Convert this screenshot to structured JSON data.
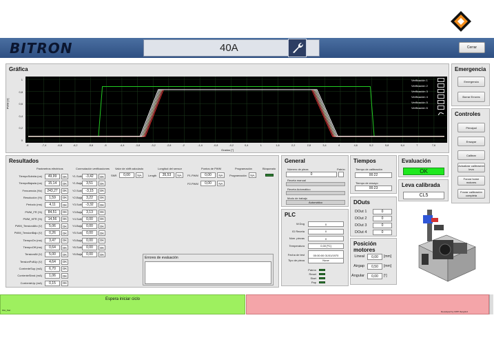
{
  "app": {
    "logo": "BITRON",
    "machine": "40A",
    "close_label": "Cerrar"
  },
  "graph": {
    "title": "Gráfica",
    "ylabel": "PWM [V]",
    "xlabel": "Grados [°]",
    "yticks": [
      "1",
      "0,8",
      "0,6",
      "0,4",
      "0,2",
      "0"
    ],
    "xticks": [
      "-8",
      "-7,4",
      "-6,8",
      "-6,2",
      "-5,6",
      "-5",
      "-4,4",
      "-3,8",
      "-3,2",
      "-2,6",
      "-2",
      "-1,4",
      "-0,8",
      "-0,2",
      "0,4",
      "1",
      "1,6",
      "2,2",
      "2,8",
      "3,4",
      "4",
      "4,6",
      "5,2",
      "5,8",
      "6,4",
      "7",
      "7,6"
    ],
    "legend": [
      "Verificación 1",
      "Verificación 2",
      "Verificación 3",
      "Verificación 4",
      "Verificación 5",
      "Verificación 6"
    ]
  },
  "chart_data": {
    "type": "line",
    "xlabel": "Grados [°]",
    "ylabel": "PWM [V]",
    "xlim": [
      -8,
      8
    ],
    "ylim": [
      0,
      1
    ],
    "series": [
      {
        "name": "Verificación 1",
        "color": "#ffffff",
        "x": [
          -8,
          -3.7,
          -3.0,
          3.1,
          3.9,
          8
        ],
        "y": [
          0.06,
          0.06,
          0.83,
          0.83,
          0.06,
          0.06
        ]
      },
      {
        "name": "Verificación 2",
        "color": "#e03030",
        "x": [
          -8,
          -3.5,
          -2.8,
          2.9,
          3.7,
          8
        ],
        "y": [
          0.06,
          0.06,
          0.83,
          0.83,
          0.06,
          0.06
        ]
      },
      {
        "name": "Verificación 3",
        "color": "#22cc22",
        "x": [
          -8,
          -5.3,
          -5.15,
          5.15,
          5.3,
          8
        ],
        "y": [
          0.06,
          0.06,
          0.88,
          0.88,
          0.06,
          0.06
        ]
      },
      {
        "name": "Verificación 4",
        "color": "#f0f0c0",
        "x": [
          -8,
          -3.6,
          -2.9,
          3.0,
          3.8,
          8
        ],
        "y": [
          0.06,
          0.06,
          0.83,
          0.83,
          0.06,
          0.06
        ]
      },
      {
        "name": "Verificación 5",
        "color": "#ff9090",
        "x": [
          -8,
          -3.55,
          -2.85,
          2.95,
          3.75,
          8
        ],
        "y": [
          0.06,
          0.06,
          0.83,
          0.83,
          0.06,
          0.06
        ]
      },
      {
        "name": "Verificación 6",
        "color": "#ffffff",
        "x": [
          -8,
          -3.65,
          -2.95,
          3.05,
          3.85,
          8
        ],
        "y": [
          0.06,
          0.06,
          0.83,
          0.83,
          0.06,
          0.06
        ]
      }
    ]
  },
  "emergencia": {
    "title": "Emergencia",
    "buttons": [
      "Emergencia",
      "Borrar Errores"
    ]
  },
  "controles": {
    "title": "Controles",
    "buttons": [
      "Principal",
      "Ensayar",
      "Calibrar",
      "Actualizar calibración leva",
      "Forzar home motores",
      "Forzar calibración completa"
    ]
  },
  "resultados": {
    "title": "Resultados",
    "headers": [
      "Parámetros eléctricos",
      "Conmutación verificaciones",
      "Valor de shift calculado",
      "Longitud del sensor",
      "Puntos de PWM",
      "Programación",
      "Bloqueado"
    ],
    "params": [
      [
        "TiempoSubida (us)",
        "49,99"
      ],
      [
        "TiempoBajada (us)",
        "15,14"
      ],
      [
        "Frecuencia (Hz)",
        "243,27"
      ],
      [
        "Resolución (%)",
        "1,59"
      ],
      [
        "Periodo (ms)",
        "4,11"
      ],
      [
        "PWM_FR (%)",
        "84,51"
      ],
      [
        "PWM_HFR (%)",
        "14,56"
      ],
      [
        "PWM_TensionAlto (V)",
        "5,06"
      ],
      [
        "PWM_TensionBajo (V)",
        "0,26"
      ],
      [
        "TiempoOn (ms)",
        "3,47"
      ],
      [
        "TiempoOff (ms)",
        "0,64"
      ],
      [
        "TensionAlt (V)",
        "5,00"
      ],
      [
        "TensionPullUp (V)",
        "4,64"
      ],
      [
        "CorrienteSup (mA)",
        "6,70"
      ],
      [
        "CorrienteSbnd (mA)",
        "1,06"
      ],
      [
        "CorrienteUp (mA)",
        "0,15"
      ]
    ],
    "verif": [
      [
        "Y1.Subida",
        "-3,42"
      ],
      [
        "Y1.Bajada",
        "3,51"
      ],
      [
        "Y2.Subida",
        "-3,15"
      ],
      [
        "Y2.Bajada",
        "3,22"
      ],
      [
        "Y3.Subida",
        "-3,32"
      ],
      [
        "Y3.Bajada",
        "3,13"
      ],
      [
        "Y4.Subida",
        "0,00"
      ],
      [
        "Y4.Bajada",
        "0,00"
      ],
      [
        "Y5.Subida",
        "0,00"
      ],
      [
        "Y5.Bajada",
        "0,00"
      ],
      [
        "Y6.Subida",
        "0,00"
      ],
      [
        "Y6.Bajada",
        "0,00"
      ]
    ],
    "ok": "OK",
    "na": "NA",
    "snr_label": "SNR",
    "snr": "0,00",
    "length_label": "Length",
    "length": "35,53",
    "p1_label": "P1.PWM",
    "p1": "0,00",
    "p2_label": "P2.PWM",
    "p2": "0,00",
    "prog_label": "Programación",
    "errors_title": "Errores de evaluación"
  },
  "general": {
    "title": "General",
    "num_pieza_label": "Número de pieza",
    "num_pieza": "0",
    "patron_label": "Patrón",
    "receta_manual_label": "Receta manual",
    "receta_auto_label": "Receta Automático",
    "modo_label": "Modo de trabajo",
    "modo": "Automático"
  },
  "tiempos": {
    "title": "Tiempos",
    "calib_label": "Tiempo de calibración",
    "calib": "00:22",
    "ensayo_label": "Tiempo de ensayo",
    "ensayo": "00:23"
  },
  "evaluacion": {
    "title": "Evaluación",
    "result": "OK"
  },
  "leva": {
    "title": "Leva calibrada",
    "value": "CL5"
  },
  "plc": {
    "title": "PLC",
    "rows": [
      [
        "W.Dog",
        "0"
      ],
      [
        "ID Receta",
        "0"
      ],
      [
        "Núm. piezas",
        "0"
      ],
      [
        "Temperatura",
        "0,00 [ºC]"
      ],
      [
        "Fecha de test",
        "00:00:00 01/01/1970"
      ],
      [
        "Tipo de pieza",
        "None"
      ]
    ],
    "leds": [
      "Patrón",
      "Reset",
      "Start",
      "Pap"
    ]
  },
  "douts": {
    "title": "DOuts",
    "rows": [
      [
        "DOut 1",
        "0"
      ],
      [
        "DOut 2",
        "0"
      ],
      [
        "DOut 3",
        "0"
      ],
      [
        "DOut 4",
        "0"
      ]
    ]
  },
  "motores": {
    "title": "Posición motores",
    "rows": [
      [
        "Lineal",
        "0,00",
        "[mm]"
      ],
      [
        "Airgap",
        "0,50",
        "[mm]"
      ],
      [
        "Angular",
        "0,00",
        "[º]"
      ]
    ]
  },
  "status": {
    "message": "Espera iniciar ciclo",
    "footer": "Developed by CIPP Ibergrind",
    "left_small": "Plot_Part"
  }
}
